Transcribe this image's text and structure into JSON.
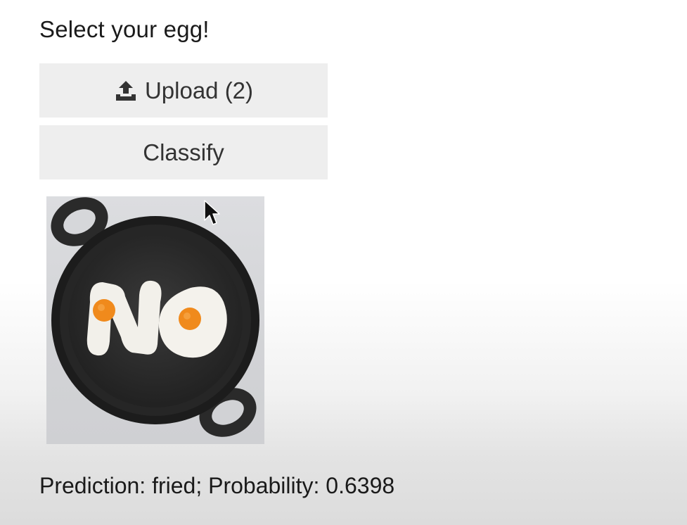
{
  "prompt": "Select your egg!",
  "upload_button": {
    "label": "Upload (2)",
    "icon": "upload-icon"
  },
  "classify_button": {
    "label": "Classify"
  },
  "image_preview": {
    "description_icon": "frying-pan-eggs-no-image"
  },
  "result": {
    "text": "Prediction: fried; Probability: 0.6398"
  },
  "colors": {
    "button_bg": "#eeeeee",
    "button_text": "#333333",
    "yolk": "#f08a1c",
    "pan": "#2a2a2a"
  }
}
